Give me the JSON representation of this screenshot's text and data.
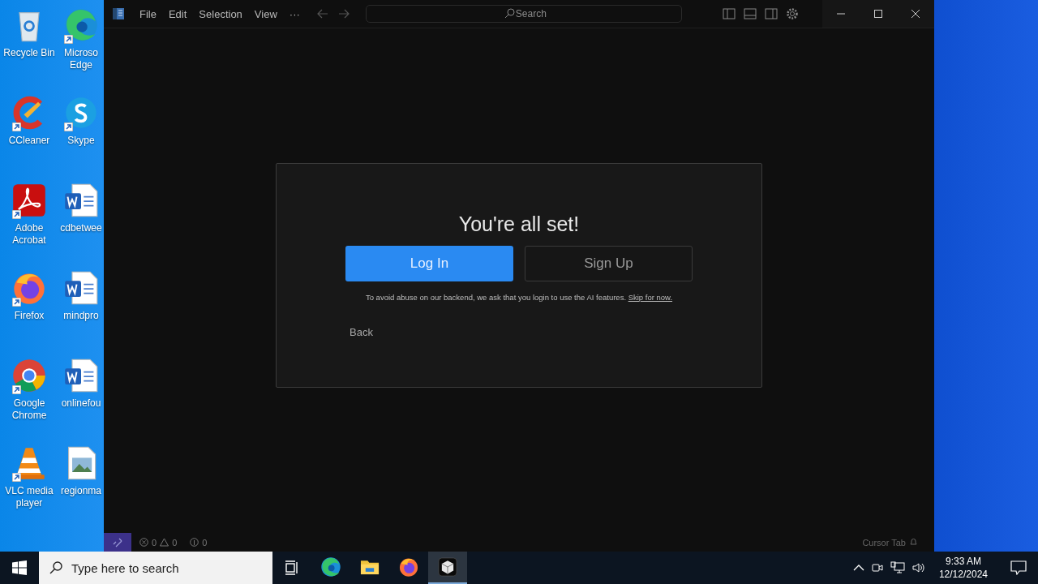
{
  "desktop": {
    "icons": [
      {
        "label": "Recycle Bin",
        "kind": "recycle",
        "shortcut": false
      },
      {
        "label": "Microso Edge",
        "kind": "edge",
        "shortcut": true
      },
      {
        "label": "CCleaner",
        "kind": "ccleaner",
        "shortcut": true
      },
      {
        "label": "Skype",
        "kind": "skype",
        "shortcut": true
      },
      {
        "label": "Adobe Acrobat",
        "kind": "acrobat",
        "shortcut": true
      },
      {
        "label": "cdbetwee",
        "kind": "word",
        "shortcut": false
      },
      {
        "label": "Firefox",
        "kind": "firefox",
        "shortcut": true
      },
      {
        "label": "mindpro",
        "kind": "word",
        "shortcut": false
      },
      {
        "label": "Google Chrome",
        "kind": "chrome",
        "shortcut": true
      },
      {
        "label": "onlinefou",
        "kind": "word",
        "shortcut": false
      },
      {
        "label": "VLC media player",
        "kind": "vlc",
        "shortcut": true
      },
      {
        "label": "regionma",
        "kind": "image",
        "shortcut": false
      }
    ]
  },
  "window": {
    "menu": [
      "File",
      "Edit",
      "Selection",
      "View",
      "···"
    ],
    "search": {
      "placeholder": "Search"
    },
    "dialog": {
      "title": "You're all set!",
      "buttons": [
        {
          "label": "Log In",
          "kind": "primary"
        },
        {
          "label": "Sign Up",
          "kind": "secondary"
        }
      ],
      "notice": "To avoid abuse on our backend, we ask that you login to use the AI features.",
      "notice_link": "Skip for now.",
      "back": "Back"
    },
    "status_bar": {
      "errors": "0",
      "warnings": "0",
      "ports": "0",
      "right": "Cursor Tab"
    }
  },
  "taskbar": {
    "search": {
      "placeholder": "Type here to search"
    },
    "apps": [
      {
        "kind": "edge",
        "selected": false
      },
      {
        "kind": "explorer",
        "selected": false
      },
      {
        "kind": "firefox",
        "selected": false
      },
      {
        "kind": "cursor",
        "selected": true
      }
    ],
    "time": "9:33 AM",
    "date": "12/12/2024"
  }
}
